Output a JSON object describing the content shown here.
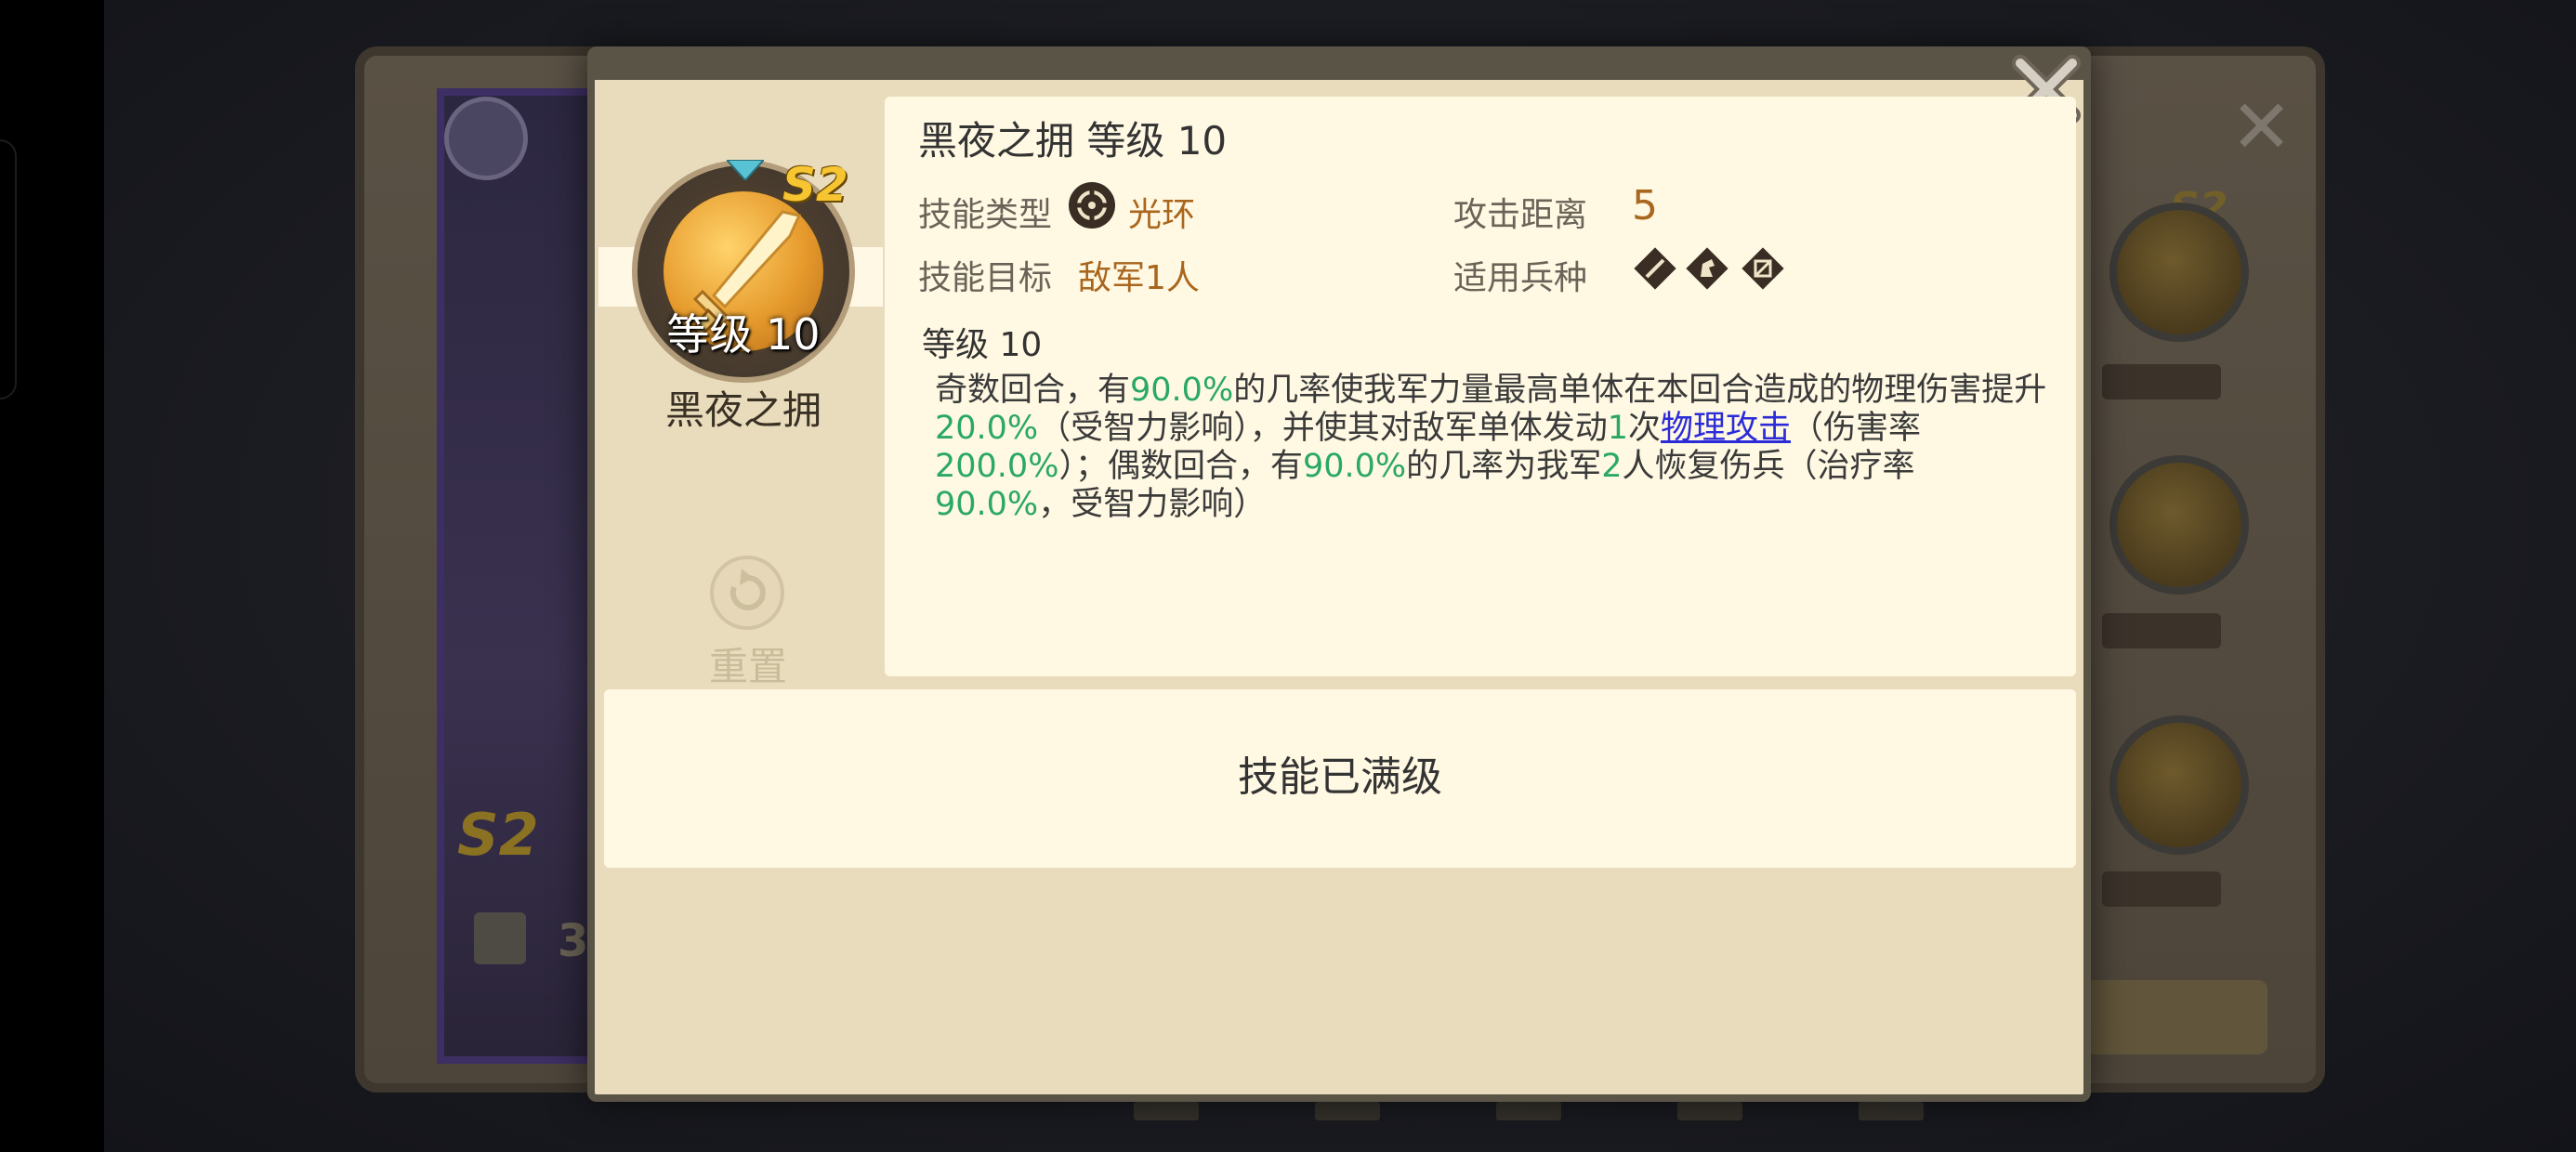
{
  "background": {
    "under_s2_badge": "S2",
    "under_count": "3"
  },
  "popup": {
    "close_icon": "close-x-icon",
    "skill": {
      "badge": "S2",
      "medal_level": "等级 10",
      "name": "黑夜之拥",
      "icon": "sword-icon"
    },
    "reset": {
      "icon": "reset-icon",
      "label": "重置"
    },
    "info": {
      "title": "黑夜之拥 等级 10",
      "type_label": "技能类型",
      "type_icon": "aura-icon",
      "type_value": "光环",
      "range_label": "攻击距离",
      "range_value": "5",
      "target_label": "技能目标",
      "target_value": "敌军1人",
      "troop_label": "适用兵种",
      "troop_icons": [
        "infantry-icon",
        "cavalry-icon",
        "archer-icon"
      ],
      "level_text": "等级 10",
      "description": {
        "p1": "奇数回合，有",
        "v1": "90.0%",
        "p2": "的几率使我军力量最高单体在本回合造成的物理伤害提升",
        "v2": "20.0%",
        "p3": "（受智力影响），并使其对敌军单体发动",
        "v3": "1",
        "p4": "次",
        "link": "物理攻击",
        "p5": "（伤害率",
        "v4": "200.0%",
        "p6": "）；偶数回合，有",
        "v5": "90.0%",
        "p7": "的几率为我军",
        "v6": "2",
        "p8": "人恢复伤兵（治疗率",
        "v7": "90.0%",
        "p9": "，受智力影响）"
      }
    },
    "max_level_text": "技能已满级"
  },
  "colors": {
    "highlight_green": "#2aa866",
    "value_brown": "#a9661d",
    "link_blue": "#2b2bd8",
    "panel_cream": "#fff8e3",
    "popup_tan": "#e9dcbc",
    "badge_gold": "#f7c531"
  }
}
